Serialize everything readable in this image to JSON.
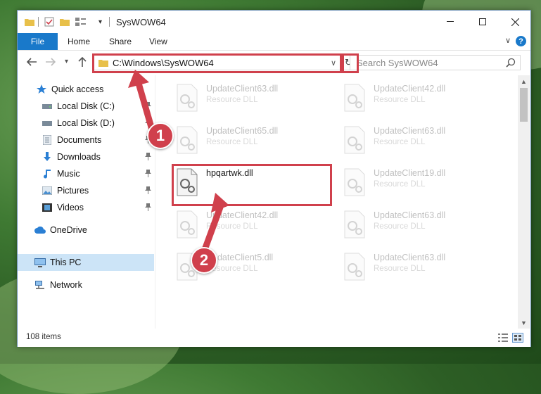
{
  "window": {
    "title": "SysWOW64"
  },
  "ribbon": {
    "file_label": "File",
    "tabs": [
      "Home",
      "Share",
      "View"
    ],
    "help_label": "?"
  },
  "address": {
    "path": "C:\\Windows\\SysWOW64"
  },
  "search": {
    "placeholder": "Search SysWOW64"
  },
  "sidebar": {
    "items": [
      {
        "label": "Quick access",
        "icon": "star-icon"
      },
      {
        "label": "Local Disk (C:)",
        "icon": "drive-icon"
      },
      {
        "label": "Local Disk (D:)",
        "icon": "drive-icon"
      },
      {
        "label": "Documents",
        "icon": "documents-icon"
      },
      {
        "label": "Downloads",
        "icon": "download-icon"
      },
      {
        "label": "Music",
        "icon": "music-icon"
      },
      {
        "label": "Pictures",
        "icon": "pictures-icon"
      },
      {
        "label": "Videos",
        "icon": "videos-icon"
      },
      {
        "label": "OneDrive",
        "icon": "cloud-icon"
      },
      {
        "label": "This PC",
        "icon": "computer-icon"
      },
      {
        "label": "Network",
        "icon": "network-icon"
      }
    ]
  },
  "files": {
    "left": [
      {
        "name": "UpdateClient63.dll",
        "type": "Resource DLL"
      },
      {
        "name": "UpdateClient65.dll",
        "type": "Resource DLL"
      },
      {
        "name": "hpqartwk.dll",
        "type": ""
      },
      {
        "name": "UpdateClient42.dll",
        "type": "Resource DLL"
      },
      {
        "name": "UpdateClient5.dll",
        "type": "Resource DLL"
      }
    ],
    "right": [
      {
        "name": "UpdateClient42.dll",
        "type": "Resource DLL"
      },
      {
        "name": "UpdateClient63.dll",
        "type": "Resource DLL"
      },
      {
        "name": "UpdateClient19.dll",
        "type": "Resource DLL"
      },
      {
        "name": "UpdateClient63.dll",
        "type": "Resource DLL"
      },
      {
        "name": "UpdateClient63.dll",
        "type": "Resource DLL"
      }
    ]
  },
  "status": {
    "item_count": "108 items"
  },
  "annotations": {
    "badge1": "1",
    "badge2": "2"
  },
  "colors": {
    "accent": "#1979ca",
    "highlight": "#d0404c",
    "selected": "#cce4f7"
  }
}
